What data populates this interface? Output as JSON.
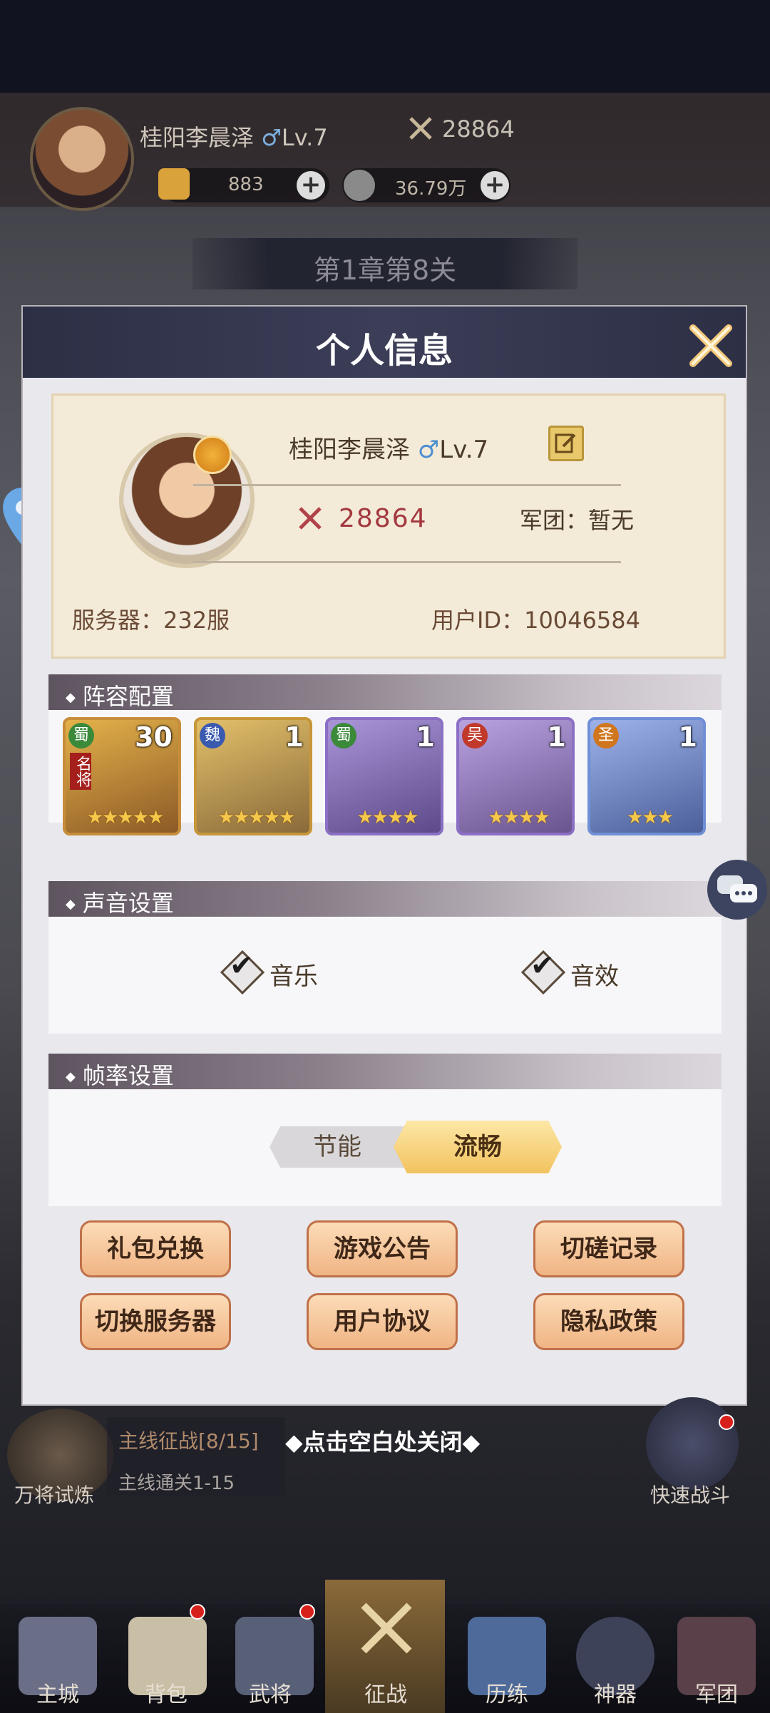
{
  "top_bar": {
    "player_name": "桂阳李晨泽",
    "gender_symbol": "♂",
    "level": "Lv.7",
    "power": "28864",
    "gold": "883",
    "coins": "36.79万",
    "stage": "第1章第8关"
  },
  "modal": {
    "title": "个人信息",
    "profile": {
      "name": "桂阳李晨泽",
      "gender_symbol": "♂",
      "level": "Lv.7",
      "power": "28864",
      "legion_label": "军团：暂无",
      "server_label": "服务器：232服",
      "uid_label": "用户ID：10046584"
    },
    "lineup": {
      "title": "阵容配置",
      "heroes": [
        {
          "faction": "蜀",
          "count": "30",
          "badge": "名将",
          "stars": "★★★★★",
          "color": "#c7883a"
        },
        {
          "faction": "魏",
          "count": "1",
          "badge": "",
          "stars": "★★★★★",
          "color": "#c7963a"
        },
        {
          "faction": "蜀",
          "count": "1",
          "badge": "",
          "stars": "★★★★",
          "color": "#8b6fc4"
        },
        {
          "faction": "吴",
          "count": "1",
          "badge": "",
          "stars": "★★★★",
          "color": "#8b6fc4"
        },
        {
          "faction": "圣",
          "count": "1",
          "badge": "",
          "stars": "★★★",
          "color": "#6f8fd6"
        }
      ]
    },
    "sound": {
      "title": "声音设置",
      "music_label": "音乐",
      "sfx_label": "音效"
    },
    "framerate": {
      "title": "帧率设置",
      "off_label": "节能",
      "on_label": "流畅"
    },
    "buttons": {
      "gift": "礼包兑换",
      "notice": "游戏公告",
      "duel_record": "切磋记录",
      "switch_server": "切换服务器",
      "user_agreement": "用户协议",
      "privacy": "隐私政策"
    }
  },
  "below": {
    "hint": "点击空白处关闭",
    "main_quest": "主线征战[8/15]",
    "main_quest_sub": "主线通关1-15",
    "trial": "万将试炼",
    "quick_battle": "快速战斗"
  },
  "nav": [
    "主城",
    "背包",
    "武将",
    "征战",
    "历练",
    "神器",
    "军团"
  ],
  "colors": {
    "accent": "#f0b483",
    "header": "#2d2f45",
    "power_red": "#a3383e"
  }
}
